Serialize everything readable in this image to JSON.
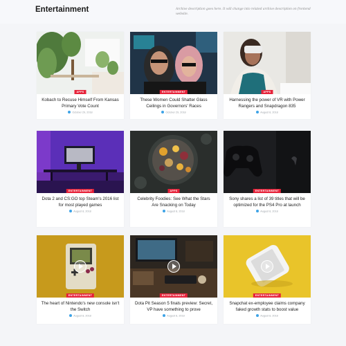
{
  "header": {
    "title": "Entertainment",
    "description": "Archive description goes here. It will change into related archive description on frontend website."
  },
  "posts": [
    {
      "title": "Kobach to Recuse Himself From Kansas Primary Vote Count",
      "category": "APPS",
      "date": "October 29, 2018",
      "play": false,
      "image": "plants-desk"
    },
    {
      "title": "These Women Could Shatter Glass Ceilings in Governors' Races",
      "category": "ENTERTAINMENT",
      "date": "October 29, 2018",
      "play": false,
      "image": "neon-couple"
    },
    {
      "title": "Harnessing the power of VR with Power Rangers and Snapdragon 835",
      "category": "APPS",
      "date": "August 8, 2018",
      "play": false,
      "image": "vr-headset"
    },
    {
      "title": "Dota 2 and CS:GO top Steam's 2016 list for most played games",
      "category": "ENTERTAINMENT",
      "date": "August 8, 2018",
      "play": false,
      "image": "purple-desk"
    },
    {
      "title": "Celebrity Foodies: See What the Stars Are Snacking on Today",
      "category": "APPS",
      "date": "August 8, 2018",
      "play": false,
      "image": "food-plate"
    },
    {
      "title": "Sony shares a list of 39 titles that will be optimized for the PS4 Pro at launch",
      "category": "ENTERTAINMENT",
      "date": "August 8, 2018",
      "play": false,
      "image": "ps4-controller"
    },
    {
      "title": "The heart of Nintendo's new console isn't the Switch",
      "category": "ENTERTAINMENT",
      "date": "August 8, 2018",
      "play": true,
      "image": "gameboy"
    },
    {
      "title": "Dota Pit Season 5 finals preview: Secret, VP have something to prove",
      "category": "ENTERTAINMENT",
      "date": "August 8, 2018",
      "play": true,
      "image": "dark-desk"
    },
    {
      "title": "Snapchat ex-employee claims company faked growth stats to boost value",
      "category": "ENTERTAINMENT",
      "date": "August 8, 2018",
      "play": true,
      "image": "phone-yellow"
    }
  ]
}
